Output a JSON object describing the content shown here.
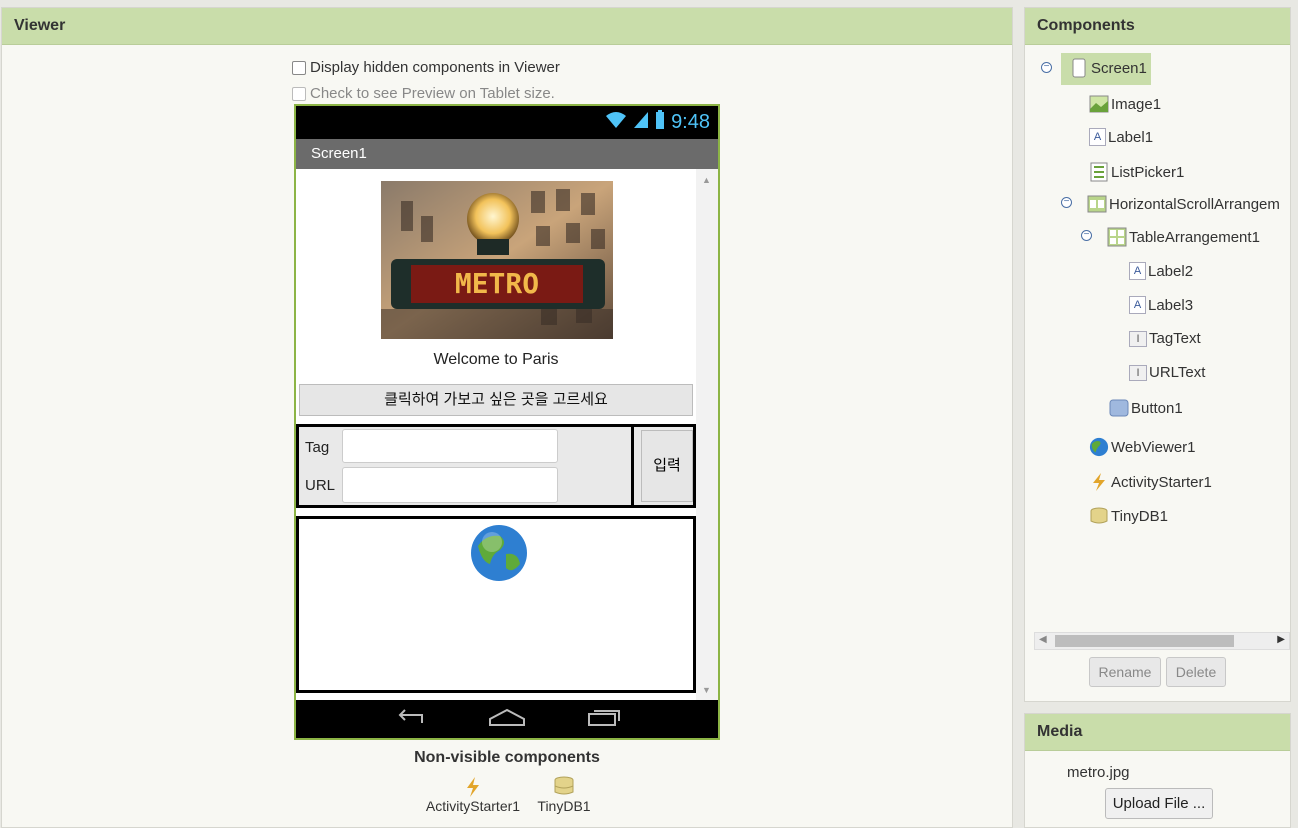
{
  "viewer": {
    "title": "Viewer",
    "show_hidden_label": "Display hidden components in Viewer",
    "tablet_preview_label": "Check to see Preview on Tablet size.",
    "phone": {
      "time": "9:48",
      "screen_title": "Screen1",
      "welcome_text": "Welcome to Paris",
      "listpicker_text": "클릭하여 가보고 싶은 곳을 고르세요",
      "tag_label": "Tag",
      "url_label": "URL",
      "tag_value": "",
      "url_value": "",
      "input_button": "입력",
      "image_sign_text": "METRO"
    },
    "nonvisible_title": "Non-visible components",
    "nonvisible": [
      {
        "label": "ActivityStarter1",
        "icon": "lightning-icon"
      },
      {
        "label": "TinyDB1",
        "icon": "database-icon"
      }
    ]
  },
  "components": {
    "title": "Components",
    "tree": [
      {
        "label": "Screen1",
        "icon": "screen-icon",
        "selected": true
      },
      {
        "label": "Image1",
        "icon": "image-icon"
      },
      {
        "label": "Label1",
        "icon": "label-icon"
      },
      {
        "label": "ListPicker1",
        "icon": "listpicker-icon"
      },
      {
        "label": "HorizontalScrollArrangem",
        "icon": "horizontal-arrangement-icon"
      },
      {
        "label": "TableArrangement1",
        "icon": "table-arrangement-icon"
      },
      {
        "label": "Label2",
        "icon": "label-icon"
      },
      {
        "label": "Label3",
        "icon": "label-icon"
      },
      {
        "label": "TagText",
        "icon": "textbox-icon"
      },
      {
        "label": "URLText",
        "icon": "textbox-icon"
      },
      {
        "label": "Button1",
        "icon": "button-icon"
      },
      {
        "label": "WebViewer1",
        "icon": "globe-icon"
      },
      {
        "label": "ActivityStarter1",
        "icon": "lightning-icon"
      },
      {
        "label": "TinyDB1",
        "icon": "database-icon"
      }
    ],
    "rename_button": "Rename",
    "delete_button": "Delete"
  },
  "media": {
    "title": "Media",
    "files": [
      "metro.jpg"
    ],
    "upload_button": "Upload File ..."
  },
  "colors": {
    "panel_header": "#c9ddaa",
    "phone_border": "#8cb445",
    "status_icons": "#4fc3f7"
  }
}
